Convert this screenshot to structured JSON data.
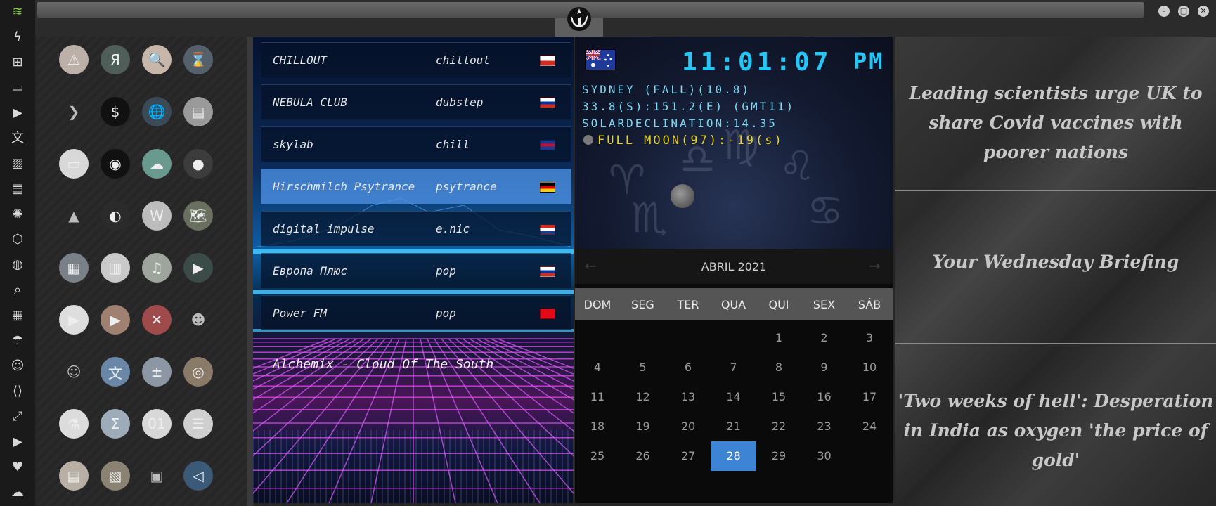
{
  "dock": {
    "icons": [
      "wifi-icon",
      "bolt-icon",
      "windows-icon",
      "archive-icon",
      "play-circle-icon",
      "translate-icon",
      "image-icon",
      "newspaper-icon",
      "rebel-icon",
      "empire-icon",
      "globe-icon",
      "search-icon",
      "map-icon",
      "umbrella-icon",
      "contacts-icon",
      "code-icon",
      "fullscreen-icon",
      "youtube-icon",
      "heart-icon",
      "cloud-icon"
    ]
  },
  "apps": [
    {
      "name": "warning-icon",
      "glyph": "⚠",
      "bg": "#bdb0a8"
    },
    {
      "name": "yandex-icon",
      "glyph": "Я",
      "bg": "#4f5e58"
    },
    {
      "name": "search-app-icon",
      "glyph": "🔍",
      "bg": "#c7b7ab"
    },
    {
      "name": "hourglass-icon",
      "glyph": "⌛",
      "bg": "#54606c"
    },
    {
      "name": "arrow-icon",
      "glyph": "❯",
      "bg": "transparent"
    },
    {
      "name": "terminal-icon",
      "glyph": "$",
      "bg": "#111"
    },
    {
      "name": "globe-app-icon",
      "glyph": "🌐",
      "bg": "#3a4a56"
    },
    {
      "name": "files-icon",
      "glyph": "▤",
      "bg": "#9a9a9a"
    },
    {
      "name": "window-icon",
      "glyph": "▭",
      "bg": "#d8d8d8"
    },
    {
      "name": "steam-icon",
      "glyph": "◉",
      "bg": "#111"
    },
    {
      "name": "cloud-lock-icon",
      "glyph": "☁",
      "bg": "#6a9a8e"
    },
    {
      "name": "github-icon",
      "glyph": "●",
      "bg": "#3c3c3c"
    },
    {
      "name": "starfleet-icon",
      "glyph": "▲",
      "bg": "transparent"
    },
    {
      "name": "deathstar-icon",
      "glyph": "◐",
      "bg": "#2b2b2b"
    },
    {
      "name": "wikipedia-icon",
      "glyph": "W",
      "bg": "#bcbcbc"
    },
    {
      "name": "worldmap-icon",
      "glyph": "🗺",
      "bg": "#6a7060"
    },
    {
      "name": "documents-icon",
      "glyph": "▦",
      "bg": "#7a8088"
    },
    {
      "name": "notebook-icon",
      "glyph": "▥",
      "bg": "#c9c9c9"
    },
    {
      "name": "music-icon",
      "glyph": "♫",
      "bg": "#9ea59c"
    },
    {
      "name": "video-icon",
      "glyph": "▶",
      "bg": "#3b4b48"
    },
    {
      "name": "play-app-icon",
      "glyph": "▶",
      "bg": "#dedede"
    },
    {
      "name": "video-player-icon",
      "glyph": "▶",
      "bg": "#a08070"
    },
    {
      "name": "close-app-icon",
      "glyph": "✕",
      "bg": "#a04b4b"
    },
    {
      "name": "robot-icon",
      "glyph": "☻",
      "bg": "transparent"
    },
    {
      "name": "c3po-icon",
      "glyph": "☺",
      "bg": "transparent"
    },
    {
      "name": "translate-app-icon",
      "glyph": "文",
      "bg": "#6a87a8"
    },
    {
      "name": "calculator-icon",
      "glyph": "±",
      "bg": "#8d96a3"
    },
    {
      "name": "camera-icon",
      "glyph": "◎",
      "bg": "#8a7a68"
    },
    {
      "name": "flask-icon",
      "glyph": "⚗",
      "bg": "#dcdcdc"
    },
    {
      "name": "sigma-icon",
      "glyph": "Σ",
      "bg": "#9dacb8"
    },
    {
      "name": "binary-icon",
      "glyph": "01",
      "bg": "#d8d8d8"
    },
    {
      "name": "text-editor-icon",
      "glyph": "☰",
      "bg": "#cfcfcf"
    },
    {
      "name": "document-icon",
      "glyph": "▤",
      "bg": "#b8b0a4"
    },
    {
      "name": "image-viewer-icon",
      "glyph": "▧",
      "bg": "#8a8272"
    },
    {
      "name": "presentation-icon",
      "glyph": "▣",
      "bg": "transparent"
    },
    {
      "name": "vscode-icon",
      "glyph": "◁",
      "bg": "#3a5a78"
    }
  ],
  "radio": {
    "stations": [
      {
        "name": "CHILLOUT",
        "genre": "chillout",
        "flag": [
          "#ffffff",
          "#d52b1e"
        ]
      },
      {
        "name": "NEBULA CLUB",
        "genre": "dubstep",
        "flag": [
          "#ffffff",
          "#0039a6",
          "#d52b1e"
        ]
      },
      {
        "name": "skylab",
        "genre": "chill",
        "flag": [
          "#1b3a8f",
          "#c8102e",
          "#1b3a8f"
        ]
      },
      {
        "name": "Hirschmilch Psytrance",
        "genre": "psytrance",
        "flag": [
          "#000000",
          "#dd0000",
          "#ffce00"
        ]
      },
      {
        "name": "digital impulse",
        "genre": "e.nic",
        "flag": [
          "#d52b1e",
          "#ffffff",
          "#1a3f8f"
        ]
      },
      {
        "name": "Европа Плюс",
        "genre": "pop",
        "flag": [
          "#ffffff",
          "#0039a6",
          "#d52b1e"
        ]
      },
      {
        "name": "Power FM",
        "genre": "pop",
        "flag": [
          "#e30a17",
          "#e30a17"
        ]
      }
    ],
    "now_playing": "Alchemix - Cloud Of The South"
  },
  "clock": {
    "time": "11:01:07",
    "ampm": "PM",
    "line1": "SYDNEY (FALL)(10.8)",
    "line2": "33.8(S):151.2(E) (GMT11)",
    "line3": "SOLARDECLINATION:14.35",
    "moon": "FULL MOON(97):-19(s)"
  },
  "calendar": {
    "title": "ABRIL 2021",
    "weekdays": [
      "DOM",
      "SEG",
      "TER",
      "QUA",
      "QUI",
      "SEX",
      "SÁB"
    ],
    "first_weekday_index": 4,
    "days_in_month": 30,
    "today": 28
  },
  "news": [
    "Leading scientists urge UK to share Covid vaccines with poorer nations",
    "Your Wednesday Briefing",
    "'Two weeks of hell': Desperation in India as oxygen 'the price of gold'"
  ]
}
